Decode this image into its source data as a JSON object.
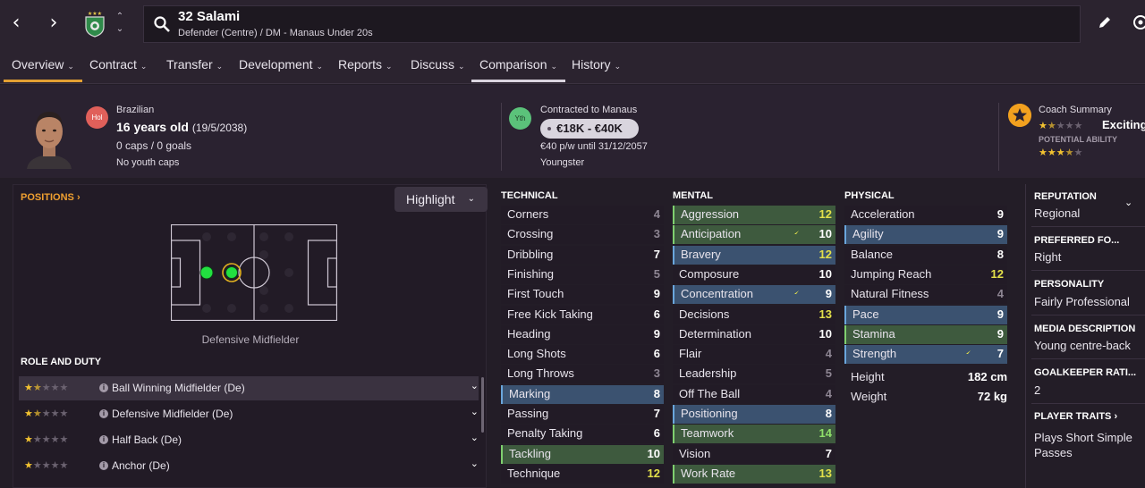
{
  "header": {
    "player_title": "32 Salami",
    "player_subtitle": "Defender (Centre) / DM - Manaus Under 20s"
  },
  "tabs": [
    {
      "label": "Overview"
    },
    {
      "label": "Contract"
    },
    {
      "label": "Transfer"
    },
    {
      "label": "Development"
    },
    {
      "label": "Reports"
    },
    {
      "label": "Discuss"
    },
    {
      "label": "Comparison"
    },
    {
      "label": "History"
    }
  ],
  "profile": {
    "nationality_badge": "Hol",
    "nationality": "Brazilian",
    "age": "16 years old",
    "dob": "(19/5/2038)",
    "caps": "0 caps / 0 goals",
    "youth_caps": "No youth caps",
    "contract_badge": "Yth",
    "contracted_to": "Contracted to Manaus",
    "value_range": "€18K - €40K",
    "wage": "€40 p/w until 31/12/2057",
    "status": "Youngster"
  },
  "coach": {
    "title": "Coach Summary",
    "verdict": "Exciting",
    "current_ability_stars": 1.5,
    "potential_label": "POTENTIAL ABILITY",
    "potential_ability_stars": 3.5
  },
  "positions": {
    "title": "POSITIONS ›",
    "highlight_label": "Highlight",
    "position_label": "Defensive Midfielder"
  },
  "roles": {
    "title": "ROLE AND DUTY",
    "items": [
      {
        "name": "Ball Winning Midfielder (De)",
        "stars": 1.5
      },
      {
        "name": "Defensive Midfielder (De)",
        "stars": 1.5
      },
      {
        "name": "Half Back (De)",
        "stars": 1
      },
      {
        "name": "Anchor (De)",
        "stars": 1
      }
    ]
  },
  "technical": {
    "title": "TECHNICAL",
    "attrs": [
      {
        "name": "Corners",
        "value": "4",
        "hl": "plain",
        "tone": "grey"
      },
      {
        "name": "Crossing",
        "value": "3",
        "hl": "plain",
        "tone": "grey"
      },
      {
        "name": "Dribbling",
        "value": "7",
        "hl": "plain",
        "tone": "white"
      },
      {
        "name": "Finishing",
        "value": "5",
        "hl": "plain",
        "tone": "grey"
      },
      {
        "name": "First Touch",
        "value": "9",
        "hl": "plain",
        "tone": "white"
      },
      {
        "name": "Free Kick Taking",
        "value": "6",
        "hl": "plain",
        "tone": "white"
      },
      {
        "name": "Heading",
        "value": "9",
        "hl": "plain",
        "tone": "white"
      },
      {
        "name": "Long Shots",
        "value": "6",
        "hl": "plain",
        "tone": "white"
      },
      {
        "name": "Long Throws",
        "value": "3",
        "hl": "plain",
        "tone": "grey"
      },
      {
        "name": "Marking",
        "value": "8",
        "hl": "blue",
        "tone": "white"
      },
      {
        "name": "Passing",
        "value": "7",
        "hl": "plain",
        "tone": "white"
      },
      {
        "name": "Penalty Taking",
        "value": "6",
        "hl": "plain",
        "tone": "white"
      },
      {
        "name": "Tackling",
        "value": "10",
        "hl": "green",
        "tone": "white"
      },
      {
        "name": "Technique",
        "value": "12",
        "hl": "plain",
        "tone": "yellow"
      }
    ]
  },
  "mental": {
    "title": "MENTAL",
    "attrs": [
      {
        "name": "Aggression",
        "value": "12",
        "hl": "green",
        "tone": "yellow"
      },
      {
        "name": "Anticipation",
        "value": "10",
        "hl": "green",
        "tone": "white",
        "arrow": true
      },
      {
        "name": "Bravery",
        "value": "12",
        "hl": "blue",
        "tone": "yellow"
      },
      {
        "name": "Composure",
        "value": "10",
        "hl": "plain",
        "tone": "white"
      },
      {
        "name": "Concentration",
        "value": "9",
        "hl": "blue",
        "tone": "white",
        "arrow": true
      },
      {
        "name": "Decisions",
        "value": "13",
        "hl": "plain",
        "tone": "yellow"
      },
      {
        "name": "Determination",
        "value": "10",
        "hl": "plain",
        "tone": "white"
      },
      {
        "name": "Flair",
        "value": "4",
        "hl": "plain",
        "tone": "grey"
      },
      {
        "name": "Leadership",
        "value": "5",
        "hl": "plain",
        "tone": "grey"
      },
      {
        "name": "Off The Ball",
        "value": "4",
        "hl": "plain",
        "tone": "grey"
      },
      {
        "name": "Positioning",
        "value": "8",
        "hl": "blue",
        "tone": "white"
      },
      {
        "name": "Teamwork",
        "value": "14",
        "hl": "green",
        "tone": "green"
      },
      {
        "name": "Vision",
        "value": "7",
        "hl": "plain",
        "tone": "white"
      },
      {
        "name": "Work Rate",
        "value": "13",
        "hl": "green",
        "tone": "yellow"
      }
    ]
  },
  "physical": {
    "title": "PHYSICAL",
    "attrs": [
      {
        "name": "Acceleration",
        "value": "9",
        "hl": "plain",
        "tone": "white"
      },
      {
        "name": "Agility",
        "value": "9",
        "hl": "blue",
        "tone": "white"
      },
      {
        "name": "Balance",
        "value": "8",
        "hl": "plain",
        "tone": "white"
      },
      {
        "name": "Jumping Reach",
        "value": "12",
        "hl": "plain",
        "tone": "yellow"
      },
      {
        "name": "Natural Fitness",
        "value": "4",
        "hl": "plain",
        "tone": "grey"
      },
      {
        "name": "Pace",
        "value": "9",
        "hl": "blue",
        "tone": "white"
      },
      {
        "name": "Stamina",
        "value": "9",
        "hl": "green",
        "tone": "white"
      },
      {
        "name": "Strength",
        "value": "7",
        "hl": "blue",
        "tone": "white",
        "arrow": true
      }
    ],
    "height_label": "Height",
    "height_value": "182 cm",
    "weight_label": "Weight",
    "weight_value": "72 kg"
  },
  "sidebar": {
    "reputation_title": "REPUTATION",
    "reputation_value": "Regional",
    "foot_title": "PREFERRED FO...",
    "foot_value": "Right",
    "personality_title": "PERSONALITY",
    "personality_value": "Fairly Professional",
    "media_title": "MEDIA DESCRIPTION",
    "media_value": "Young centre-back",
    "gk_title": "GOALKEEPER RATI...",
    "gk_value": "2",
    "traits_title": "PLAYER TRAITS ›",
    "traits_value_line1": "Plays Short Simple",
    "traits_value_line2": "Passes"
  },
  "colors": {
    "accent": "#e3a033",
    "highlight_blue": "#3b5270",
    "highlight_green": "#3e5a3e",
    "star": "#f2c230",
    "position_natural": "#22e040"
  }
}
